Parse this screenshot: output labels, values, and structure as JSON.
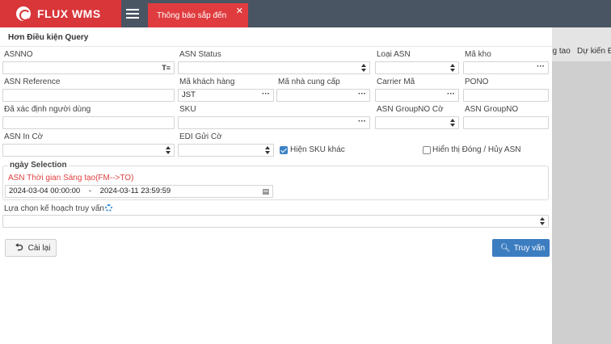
{
  "app": {
    "logo": "FLUX WMS",
    "active_tab": "Thông báo sắp đến",
    "tab_close": "✕"
  },
  "background_columns": [
    "ng tao",
    "Dự kiến Đ"
  ],
  "panel": {
    "title": "Hơn Điều kiện Query",
    "fields": {
      "asnno": {
        "label": "ASNNO",
        "value": ""
      },
      "asn_status": {
        "label": "ASN Status",
        "value": ""
      },
      "loai_asn": {
        "label": "Loại ASN",
        "value": ""
      },
      "ma_kho": {
        "label": "Mã kho",
        "value": ""
      },
      "asn_reference": {
        "label": "ASN Reference",
        "value": ""
      },
      "ma_khach_hang": {
        "label": "Mã khách hàng",
        "value": "JST"
      },
      "ma_ncc": {
        "label": "Mã nhà cung cấp",
        "value": ""
      },
      "carrier_ma": {
        "label": "Carrier Mã",
        "value": ""
      },
      "pono": {
        "label": "PONO",
        "value": ""
      },
      "user": {
        "label": "Đã xác định người dùng",
        "value": ""
      },
      "sku": {
        "label": "SKU",
        "value": ""
      },
      "asn_groupno_co": {
        "label": "ASN GroupNO Cờ",
        "value": ""
      },
      "asn_groupno": {
        "label": "ASN GroupNO",
        "value": ""
      },
      "asn_in_co": {
        "label": "ASN In Cờ",
        "value": ""
      },
      "edi_gui_co": {
        "label": "EDI Gửi Cờ",
        "value": ""
      }
    },
    "checkboxes": {
      "show_sku": {
        "label": "Hiện SKU khác",
        "checked": true
      },
      "show_closed": {
        "label": "Hiển thị Đóng / Hủy ASN",
        "checked": false
      }
    },
    "date_section": {
      "legend": "ngày Selection",
      "label": "ASN Thời gian Sáng tạo(FM-->TO)",
      "from": "2024-03-04 00:00:00",
      "separator": "-",
      "to": "2024-03-11 23:59:59"
    },
    "plan": {
      "label": "Lựa chọn kế hoạch truy vấn",
      "value": ""
    },
    "buttons": {
      "reset": "Cài lại",
      "query": "Truy vấn"
    }
  },
  "colors": {
    "brand_red": "#d9363a",
    "topbar": "#4a5563",
    "primary_blue": "#3c7dc0",
    "date_label_red": "#e04040"
  },
  "icons": [
    "flux-logo-icon",
    "menu-list-icon",
    "close-icon",
    "filter-list-icon",
    "select-arrows-icon",
    "more-dots-icon",
    "calendar-icon",
    "gear-icon",
    "undo-icon",
    "search-icon"
  ]
}
